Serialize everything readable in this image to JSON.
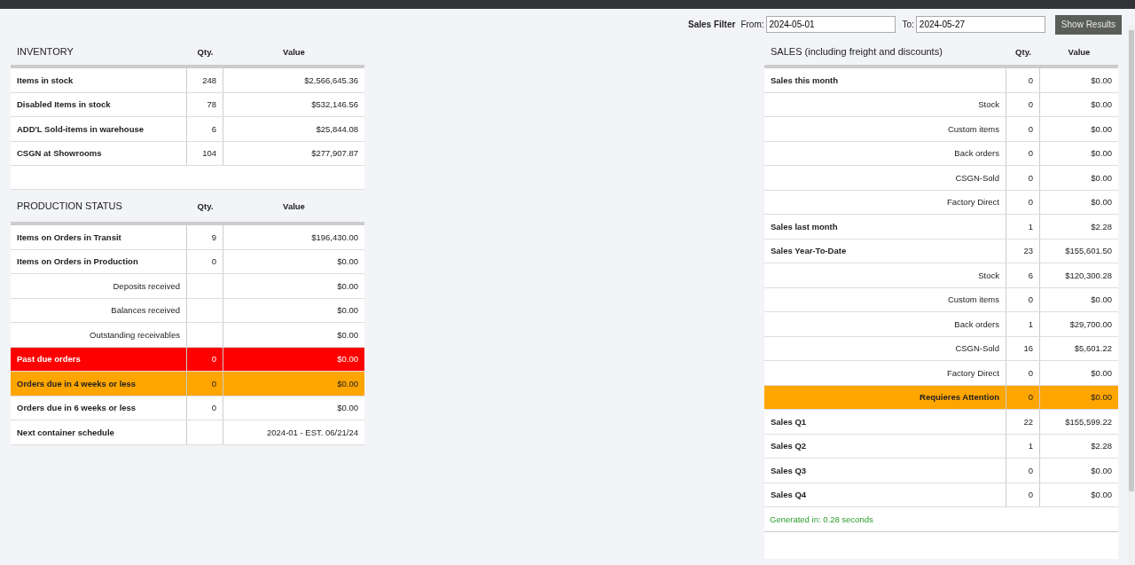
{
  "filter": {
    "label": "Sales Filter",
    "from_label": "From:",
    "from": "2024-05-01",
    "to_label": "To:",
    "to": "2024-05-27",
    "button": "Show Results"
  },
  "inventory": {
    "title": "INVENTORY",
    "qty_header": "Qty.",
    "value_header": "Value",
    "rows": [
      {
        "kind": "main",
        "label": "Items in stock",
        "qty": "248",
        "value": "$2,566,645.36"
      },
      {
        "kind": "main",
        "label": "Disabled Items in stock",
        "qty": "78",
        "value": "$532,146.56"
      },
      {
        "kind": "main",
        "label": "ADD'L Sold-items in warehouse",
        "qty": "6",
        "value": "$25,844.08"
      },
      {
        "kind": "main",
        "label": "CSGN at Showrooms",
        "qty": "104",
        "value": "$277,907.87"
      }
    ]
  },
  "production": {
    "title": "PRODUCTION STATUS",
    "qty_header": "Qty.",
    "value_header": "Value",
    "rows": [
      {
        "kind": "main",
        "label": "Items on Orders in Transit",
        "qty": "9",
        "value": "$196,430.00"
      },
      {
        "kind": "main",
        "label": "Items on Orders in Production",
        "qty": "0",
        "value": "$0.00"
      },
      {
        "kind": "sub",
        "label": "Deposits received",
        "value": "$0.00"
      },
      {
        "kind": "sub",
        "label": "Balances received",
        "value": "$0.00"
      },
      {
        "kind": "sub",
        "label": "Outstanding receivables",
        "value": "$0.00"
      },
      {
        "kind": "main",
        "color": "#ff0000",
        "label": "Past due orders",
        "qty": "0",
        "value": "$0.00"
      },
      {
        "kind": "main",
        "color": "#ffa500",
        "label": "Orders due in 4 weeks or less",
        "qty": "0",
        "value": "$0.00"
      },
      {
        "kind": "main",
        "label": "Orders due in 6 weeks or less",
        "qty": "0",
        "value": "$0.00"
      },
      {
        "kind": "main",
        "label": "Next container schedule",
        "value": "2024-01 - EST. 06/21/24"
      }
    ]
  },
  "sales": {
    "title": "SALES (including freight and discounts)",
    "qty_header": "Qty.",
    "value_header": "Value",
    "rows": [
      {
        "kind": "main",
        "label": "Sales this month",
        "qty": "0",
        "value": "$0.00"
      },
      {
        "kind": "sub",
        "label": "Stock",
        "qty": "0",
        "value": "$0.00"
      },
      {
        "kind": "sub",
        "label": "Custom items",
        "qty": "0",
        "value": "$0.00"
      },
      {
        "kind": "sub",
        "label": "Back orders",
        "qty": "0",
        "value": "$0.00"
      },
      {
        "kind": "sub",
        "label": "CSGN-Sold",
        "qty": "0",
        "value": "$0.00"
      },
      {
        "kind": "sub",
        "label": "Factory Direct",
        "qty": "0",
        "value": "$0.00"
      },
      {
        "kind": "main",
        "label": "Sales last month",
        "qty": "1",
        "value": "$2.28"
      },
      {
        "kind": "main",
        "label": "Sales Year-To-Date",
        "qty": "23",
        "value": "$155,601.50"
      },
      {
        "kind": "sub",
        "label": "Stock",
        "qty": "6",
        "value": "$120,300.28"
      },
      {
        "kind": "sub",
        "label": "Custom items",
        "qty": "0",
        "value": "$0.00"
      },
      {
        "kind": "sub",
        "label": "Back orders",
        "qty": "1",
        "value": "$29,700.00"
      },
      {
        "kind": "sub",
        "label": "CSGN-Sold",
        "qty": "16",
        "value": "$5,601.22"
      },
      {
        "kind": "sub",
        "label": "Factory Direct",
        "qty": "0",
        "value": "$0.00"
      },
      {
        "kind": "sub",
        "color": "#ffa500",
        "label": "Requieres Attention",
        "qty": "0",
        "value": "$0.00"
      },
      {
        "kind": "main",
        "label": "Sales Q1",
        "qty": "22",
        "value": "$155,599.22"
      },
      {
        "kind": "main",
        "label": "Sales Q2",
        "qty": "1",
        "value": "$2.28"
      },
      {
        "kind": "main",
        "label": "Sales Q3",
        "qty": "0",
        "value": "$0.00"
      },
      {
        "kind": "main",
        "label": "Sales Q4",
        "qty": "0",
        "value": "$0.00"
      }
    ],
    "generated": "Generated in: 0.28 seconds"
  }
}
